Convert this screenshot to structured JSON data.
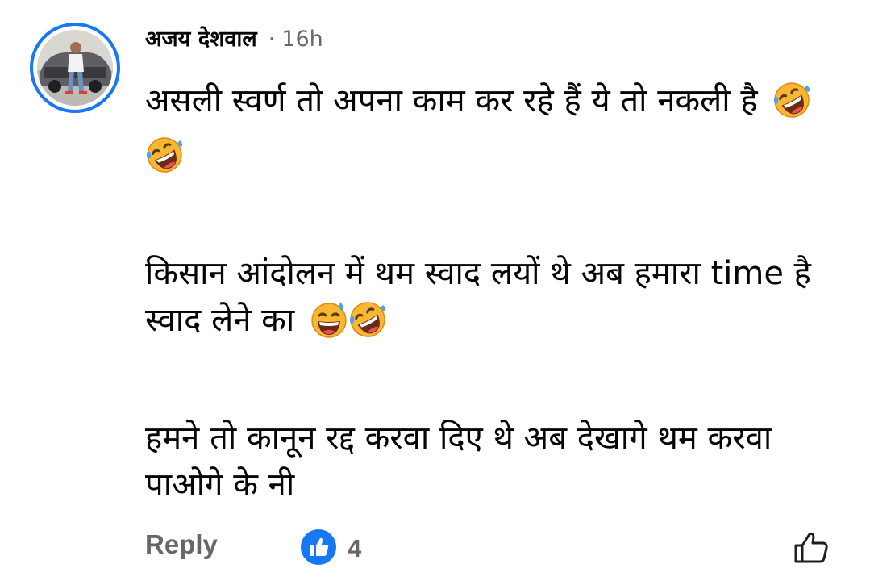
{
  "comment": {
    "author": "अजय देशवाल",
    "separator": "·",
    "time": "16h",
    "paragraphs": [
      "असली स्वर्ण तो अपना काम कर रहे हैं ये तो नकली है",
      "किसान आंदोलन में थम स्वाद लयों थे अब हमारा time है स्वाद लेने का",
      "हमने तो कानून रद्द करवा दिए थे अब देखागे थम करवा पाओगे के नी"
    ],
    "emojis": {
      "p1": [
        "rolling-on-floor-laughing",
        "rolling-on-floor-laughing"
      ],
      "p2": [
        "grinning-sweat",
        "rolling-on-floor-laughing"
      ]
    }
  },
  "actions": {
    "reply_label": "Reply",
    "reaction_icon": "like-reaction-icon",
    "reaction_count": "4",
    "like_icon": "thumbs-up-outline-icon"
  },
  "colors": {
    "avatar_ring": "#1877f2",
    "meta_text": "#65676b",
    "body_text": "#050505",
    "like_badge": "#1877f2"
  }
}
